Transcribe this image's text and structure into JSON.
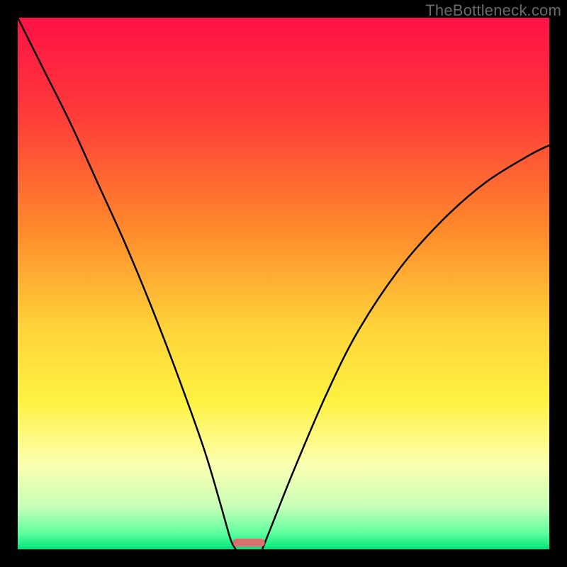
{
  "watermark": "TheBottleneck.com",
  "chart_data": {
    "type": "line",
    "title": "",
    "xlabel": "",
    "ylabel": "",
    "xlim": [
      0,
      100
    ],
    "ylim": [
      0,
      100
    ],
    "gradient_stops": [
      {
        "offset": 0,
        "color": "#ff1146"
      },
      {
        "offset": 18,
        "color": "#ff3a3a"
      },
      {
        "offset": 40,
        "color": "#ff8a2b"
      },
      {
        "offset": 58,
        "color": "#ffd23a"
      },
      {
        "offset": 72,
        "color": "#fff240"
      },
      {
        "offset": 84,
        "color": "#fdffb0"
      },
      {
        "offset": 92,
        "color": "#c8ffb8"
      },
      {
        "offset": 97,
        "color": "#5dff9e"
      },
      {
        "offset": 100,
        "color": "#00e47a"
      }
    ],
    "series": [
      {
        "name": "left-curve",
        "x": [
          0,
          5,
          10,
          15,
          20,
          25,
          30,
          35,
          38,
          40,
          41
        ],
        "y": [
          100,
          90,
          80,
          69,
          58,
          46,
          33,
          19,
          9,
          2,
          0
        ]
      },
      {
        "name": "right-curve",
        "x": [
          46,
          48,
          52,
          58,
          64,
          72,
          80,
          88,
          96,
          100
        ],
        "y": [
          0,
          5,
          15,
          29,
          41,
          53,
          62,
          69,
          74,
          76
        ]
      }
    ],
    "marker": {
      "x": 43.5,
      "y": 0.5,
      "width": 6,
      "height": 1.5,
      "color": "#d9706f"
    }
  }
}
